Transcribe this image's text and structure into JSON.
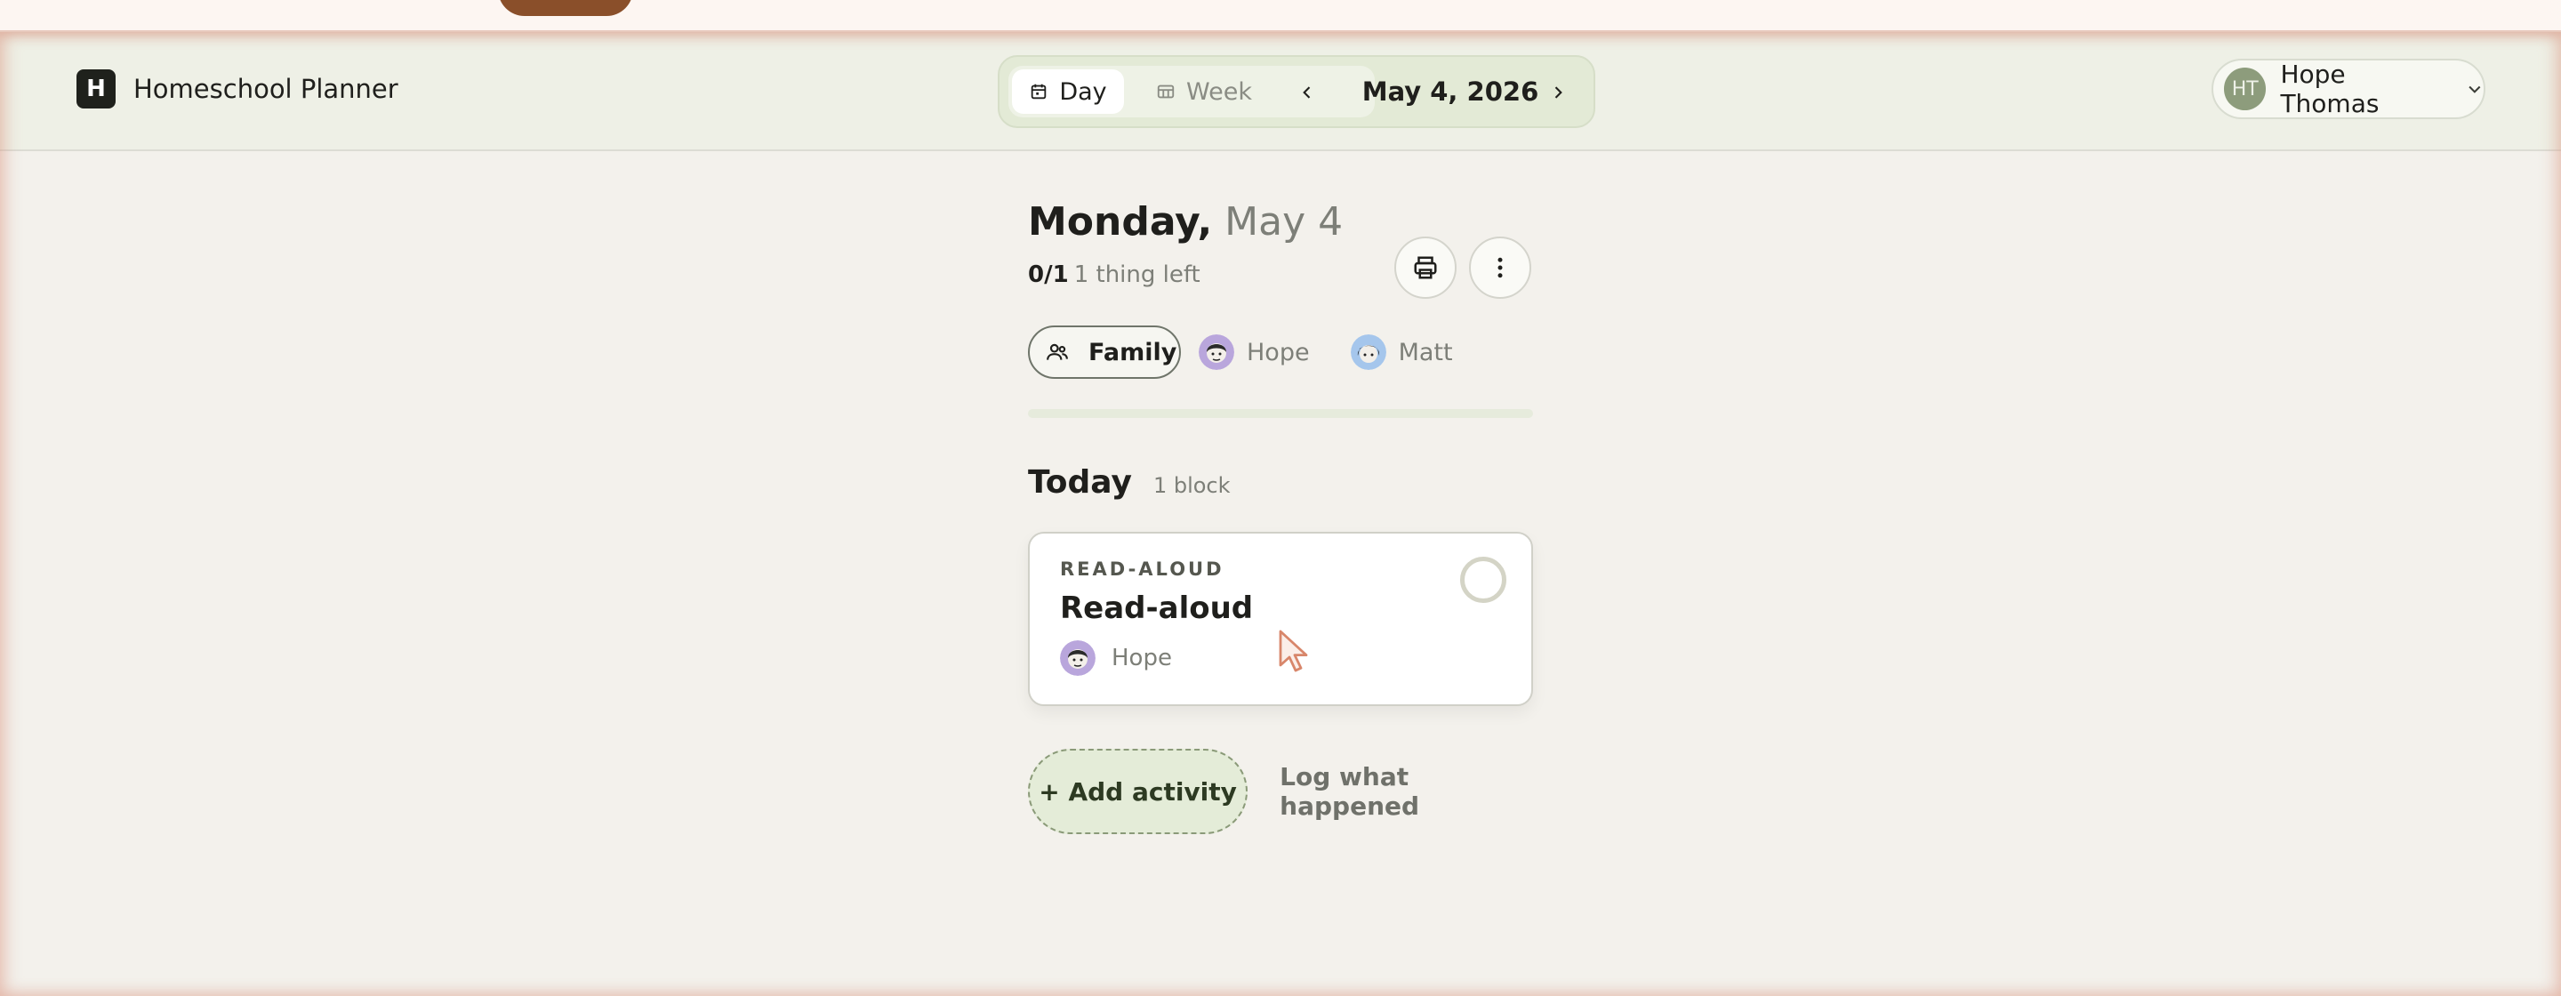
{
  "app": {
    "name": "Homeschool Planner",
    "logo_letter": "H"
  },
  "view_toggle": {
    "day_label": "Day",
    "week_label": "Week",
    "selected": "Day"
  },
  "date_nav": {
    "current": "May 4, 2026"
  },
  "user": {
    "initials": "HT",
    "name": "Hope Thomas"
  },
  "day": {
    "weekday": "Monday,",
    "date": "May 4",
    "progress_count": "0/1",
    "progress_left": "1 thing left",
    "progress_fraction": 0
  },
  "filters": {
    "family": "Family",
    "members": [
      "Hope",
      "Matt"
    ]
  },
  "today": {
    "title": "Today",
    "count": "1 block"
  },
  "blocks": [
    {
      "kicker": "READ-ALOUD",
      "title": "Read-aloud",
      "assignee": "Hope"
    }
  ],
  "actions": {
    "add": "+ Add activity",
    "log": "Log what happened"
  },
  "icons": {
    "day": "calendar-icon",
    "week": "calendar-grid-icon",
    "prev": "chevron-left-icon",
    "next": "chevron-right-icon",
    "user_menu": "chevron-down-icon",
    "print": "printer-icon",
    "more": "more-vertical-icon",
    "family": "users-icon"
  },
  "colors": {
    "accent": "#8a4f2a",
    "check_border": "#d4d4c6",
    "add_bg": "#e4ecd8"
  }
}
